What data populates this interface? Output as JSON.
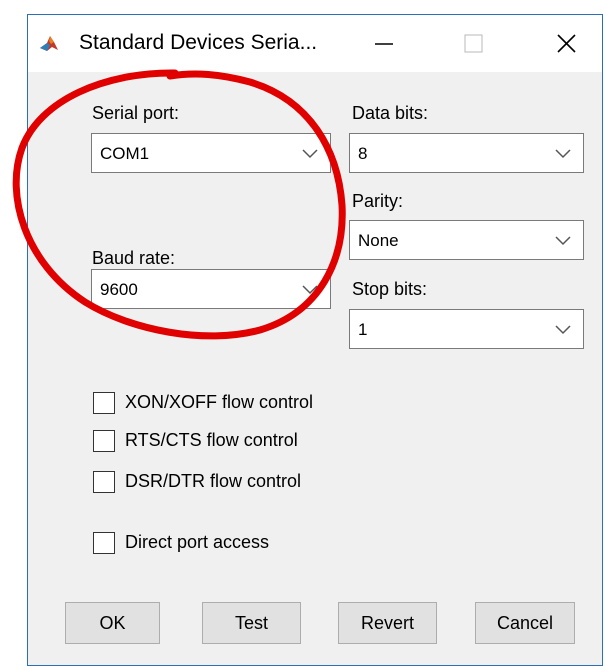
{
  "window": {
    "title": "Standard Devices Seria...",
    "minimize_icon": "minimize-icon",
    "maximize_icon": "maximize-icon",
    "close_icon": "close-icon",
    "border_color": "#2b6fb8"
  },
  "serial_port": {
    "label": "Serial port:",
    "value": "COM1"
  },
  "baud_rate": {
    "label": "Baud rate:",
    "value": "9600"
  },
  "data_bits": {
    "label": "Data bits:",
    "value": "8"
  },
  "parity": {
    "label": "Parity:",
    "value": "None"
  },
  "stop_bits": {
    "label": "Stop bits:",
    "value": "1"
  },
  "options": {
    "xon_xoff": {
      "label": "XON/XOFF flow control",
      "checked": false
    },
    "rts_cts": {
      "label": "RTS/CTS flow control",
      "checked": false
    },
    "dsr_dtr": {
      "label": "DSR/DTR flow control",
      "checked": false
    },
    "direct_port": {
      "label": "Direct port access",
      "checked": false
    }
  },
  "buttons": {
    "ok": "OK",
    "test": "Test",
    "revert": "Revert",
    "cancel": "Cancel"
  },
  "annotation": {
    "color": "#e00000"
  }
}
